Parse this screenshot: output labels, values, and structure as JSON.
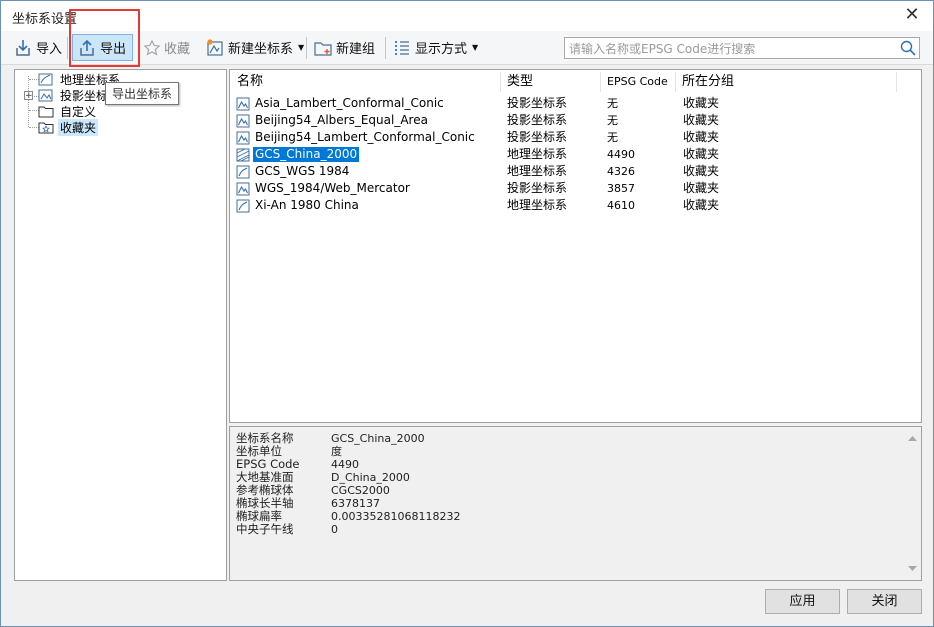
{
  "window": {
    "title": "坐标系设置"
  },
  "toolbar": {
    "import_label": "导入",
    "export_label": "导出",
    "favorite_label": "收藏",
    "new_crs_label": "新建坐标系",
    "new_group_label": "新建组",
    "display_mode_label": "显示方式"
  },
  "search": {
    "placeholder": "请输入名称或EPSG Code进行搜索"
  },
  "tooltip": {
    "text": "导出坐标系"
  },
  "tree": {
    "items": [
      {
        "label": "地理坐标系"
      },
      {
        "label": "投影坐标"
      },
      {
        "label": "自定义"
      },
      {
        "label": "收藏夹"
      }
    ]
  },
  "list": {
    "headers": {
      "name": "名称",
      "type": "类型",
      "epsg": "EPSG Code",
      "group": "所在分组"
    },
    "rows": [
      {
        "name": "Asia_Lambert_Conformal_Conic",
        "type": "投影坐标系",
        "epsg": "无",
        "group": "收藏夹",
        "icon": "projected-crs-icon"
      },
      {
        "name": "Beijing54_Albers_Equal_Area",
        "type": "投影坐标系",
        "epsg": "无",
        "group": "收藏夹",
        "icon": "projected-crs-icon"
      },
      {
        "name": "Beijing54_Lambert_Conformal_Conic",
        "type": "投影坐标系",
        "epsg": "无",
        "group": "收藏夹",
        "icon": "projected-crs-icon"
      },
      {
        "name": "GCS_China_2000",
        "type": "地理坐标系",
        "epsg": "4490",
        "group": "收藏夹",
        "icon": "geographic-crs-icon"
      },
      {
        "name": "GCS_WGS 1984",
        "type": "地理坐标系",
        "epsg": "4326",
        "group": "收藏夹",
        "icon": "geographic-crs-icon"
      },
      {
        "name": "WGS_1984/Web_Mercator",
        "type": "投影坐标系",
        "epsg": "3857",
        "group": "收藏夹",
        "icon": "projected-crs-icon"
      },
      {
        "name": "Xi-An 1980 China",
        "type": "地理坐标系",
        "epsg": "4610",
        "group": "收藏夹",
        "icon": "geographic-crs-icon"
      }
    ]
  },
  "details": {
    "props": [
      {
        "label": "坐标系名称",
        "value": "GCS_China_2000"
      },
      {
        "label": "坐标单位",
        "value": "度"
      },
      {
        "label": "EPSG Code",
        "value": "4490"
      },
      {
        "label": "大地基准面",
        "value": "D_China_2000"
      },
      {
        "label": "参考椭球体",
        "value": "CGCS2000"
      },
      {
        "label": "椭球长半轴",
        "value": "6378137"
      },
      {
        "label": "椭球扁率",
        "value": "0.00335281068118232"
      },
      {
        "label": "中央子午线",
        "value": "0"
      }
    ]
  },
  "buttons": {
    "apply_label": "应用",
    "close_label": "关闭"
  },
  "colors": {
    "selection": "#0078d7",
    "highlight_border": "#e53935",
    "toolbar_active": "#cde6f7"
  }
}
